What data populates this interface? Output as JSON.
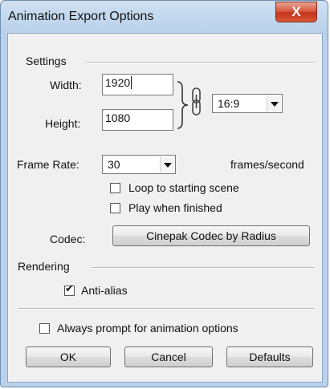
{
  "window": {
    "title": "Animation Export Options",
    "close_label": "X"
  },
  "settings": {
    "group_label": "Settings",
    "width_label": "Width:",
    "width_value": "1920",
    "height_label": "Height:",
    "height_value": "1080",
    "aspect_ratio": "16:9",
    "frame_rate_label": "Frame Rate:",
    "frame_rate_value": "30",
    "frame_rate_unit": "frames/second",
    "loop_label": "Loop to starting scene",
    "loop_checked": false,
    "play_label": "Play when finished",
    "play_checked": false,
    "codec_label": "Codec:",
    "codec_button": "Cinepak Codec by Radius"
  },
  "rendering": {
    "group_label": "Rendering",
    "antialias_label": "Anti-alias",
    "antialias_checked": true
  },
  "always_prompt": {
    "label": "Always prompt for animation options",
    "checked": false
  },
  "buttons": {
    "ok": "OK",
    "cancel": "Cancel",
    "defaults": "Defaults"
  },
  "icons": {
    "link": "chain-link-icon",
    "bracket": "curly-brace-icon",
    "dropdown": "chevron-down-icon"
  }
}
